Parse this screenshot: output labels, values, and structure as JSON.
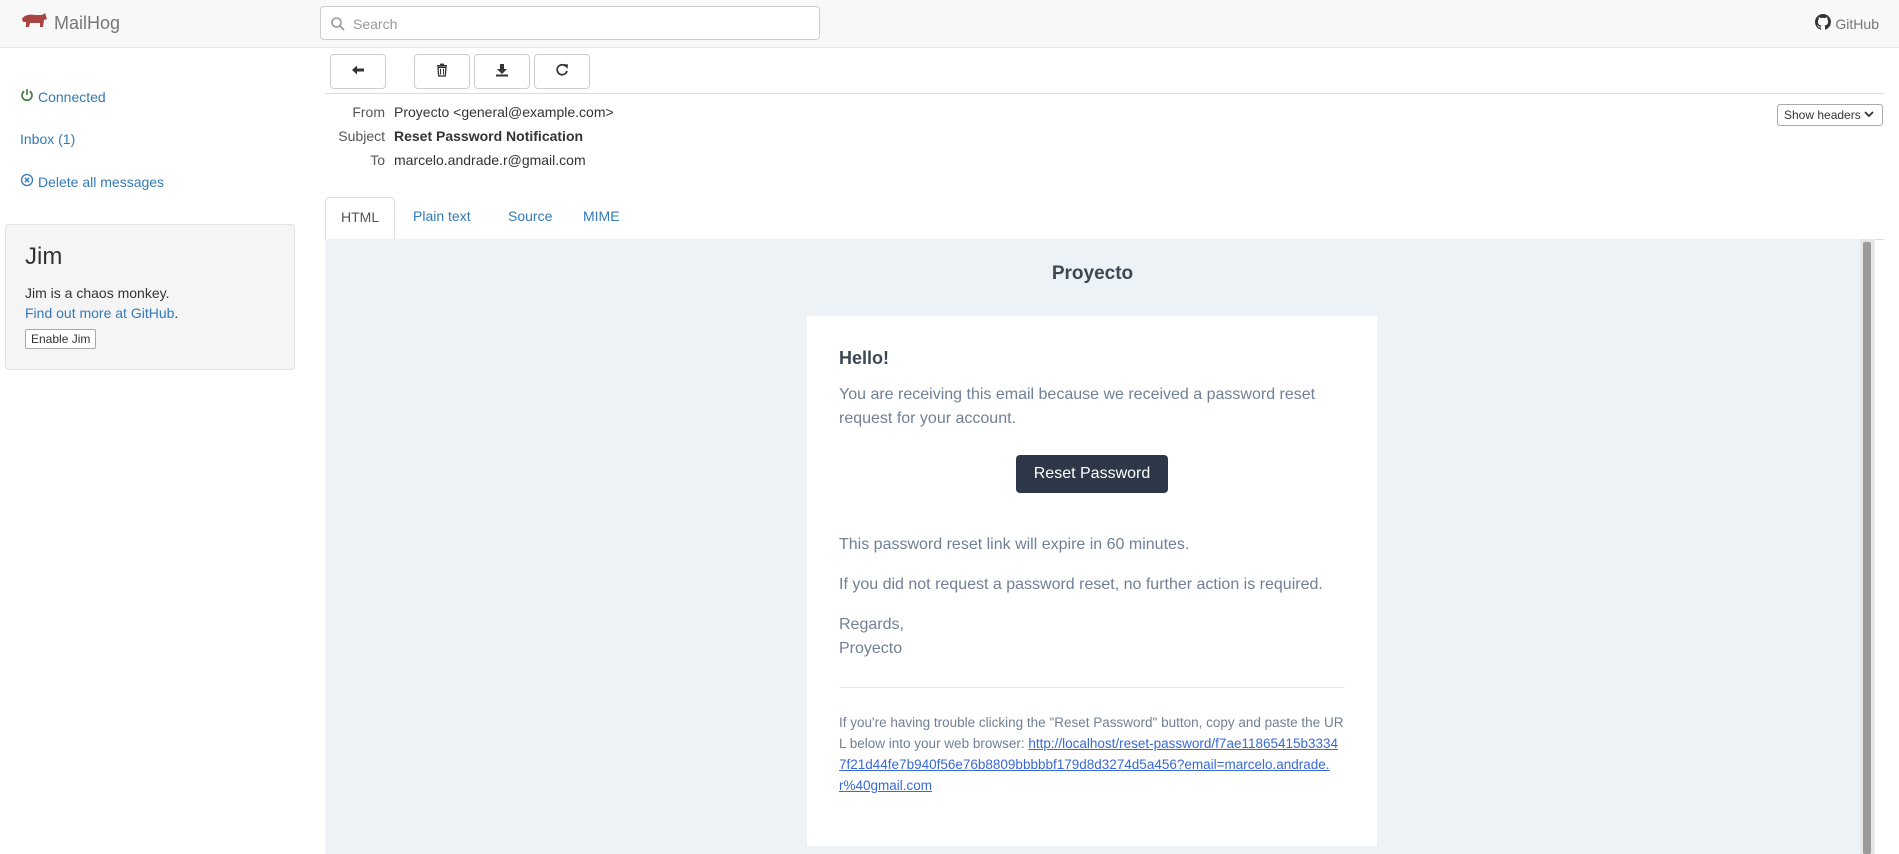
{
  "app": {
    "brand": "MailHog",
    "github_label": "GitHub"
  },
  "search": {
    "placeholder": "Search"
  },
  "sidebar": {
    "connected": "Connected",
    "inbox": "Inbox (1)",
    "delete_all": "Delete all messages"
  },
  "jim": {
    "title": "Jim",
    "description": "Jim is a chaos monkey.",
    "link_text": "Find out more at GitHub",
    "link_suffix": ".",
    "enable_button": "Enable Jim"
  },
  "headers": {
    "from_label": "From",
    "from_value": "Proyecto <general@example.com>",
    "subject_label": "Subject",
    "subject_value": "Reset Password Notification",
    "to_label": "To",
    "to_value": "marcelo.andrade.r@gmail.com",
    "show_headers": "Show headers"
  },
  "tabs": [
    {
      "label": "HTML",
      "active": true
    },
    {
      "label": "Plain text"
    },
    {
      "label": "Source"
    },
    {
      "label": "MIME"
    }
  ],
  "email": {
    "header_title": "Proyecto",
    "greeting": "Hello!",
    "intro": "You are receiving this email because we received a password reset request for your account.",
    "button_label": "Reset Password",
    "expire": "This password reset link will expire in 60 minutes.",
    "no_action": "If you did not request a password reset, no further action is required.",
    "regards": "Regards,",
    "signature": "Proyecto",
    "subcopy_text": "If you're having trouble clicking the \"Reset Password\" button, copy and paste the URL below into your web browser: ",
    "subcopy_link": "http://localhost/reset-password/f7ae11865415b33347f21d44fe7b940f56e76b8809bbbbbf179d8d3274d5a456?email=marcelo.andrade.r%40gmail.com"
  },
  "colors": {
    "link": "#337ab7",
    "connected_icon": "#3c763d",
    "preview_bg": "#edf2f7",
    "button_bg": "#2d3748",
    "brand_icon": "#a94442"
  },
  "icons": {
    "brand": "hog-icon",
    "search": "search-icon",
    "github": "github-icon",
    "connected": "power-icon",
    "delete": "remove-circle-icon",
    "back": "arrow-left-icon",
    "trash": "trash-icon",
    "download": "download-icon",
    "release": "share-icon",
    "dropdown": "chevron-down-icon"
  }
}
